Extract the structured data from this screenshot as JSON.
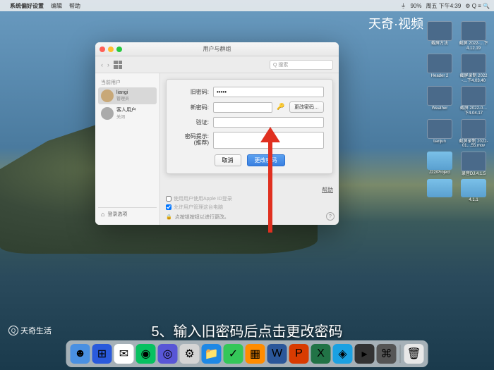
{
  "menubar": {
    "apple": "",
    "app": "系统偏好设置",
    "items": [
      "编辑",
      "帮助"
    ],
    "right": {
      "wifi": "⏚",
      "battery": "90%",
      "time": "周五 下午4:39",
      "icons": "⚙ Q ≡ 🔍"
    }
  },
  "watermark": "天奇·视频",
  "desktop": {
    "items": [
      {
        "type": "thumb",
        "label": "截屏方法"
      },
      {
        "type": "thumb",
        "label": "截屏\n2022-…下4.12.19"
      },
      {
        "type": "thumb",
        "label": "Header 2"
      },
      {
        "type": "thumb",
        "label": "截屏录制\n2022-…下4.03.40"
      },
      {
        "type": "thumb",
        "label": "Weather"
      },
      {
        "type": "thumb",
        "label": "截屏\n2022-0…下4.04.17"
      },
      {
        "type": "thumb",
        "label": "tianjun"
      },
      {
        "type": "thumb",
        "label": "截屏录制\n2022-01…55.mov"
      },
      {
        "type": "folder",
        "label": "J22/Project"
      },
      {
        "type": "thumb",
        "label": "录音DJ.4.1.5"
      },
      {
        "type": "folder",
        "label": ""
      },
      {
        "type": "folder",
        "label": "4.1.1"
      }
    ]
  },
  "modal": {
    "title": "用户与群组",
    "search_placeholder": "Q 搜索",
    "sidebar": {
      "section": "当前用户",
      "users": [
        {
          "name": "liangi",
          "role": "管理员",
          "active": true
        },
        {
          "name": "客人用户",
          "role": "关闭",
          "active": false
        }
      ],
      "login_options": "登录选项"
    },
    "form": {
      "old_password": {
        "label": "旧密码:",
        "value": "•••••"
      },
      "new_password": {
        "label": "新密码:",
        "value": ""
      },
      "verify": {
        "label": "验证:",
        "value": ""
      },
      "hint": {
        "label": "密码提示:\n(推荐)",
        "value": ""
      },
      "change_side": "更改密码…",
      "cancel": "取消",
      "confirm": "更改密码"
    },
    "bottom": {
      "help": "帮助",
      "check1": "使用用户使用Apple ID登录",
      "check2": "允许用户管理这台电脑",
      "lock": "点按锁按钮以进行更改。"
    }
  },
  "caption": "5、输入旧密码后点击更改密码",
  "brand": "天奇生活",
  "dock": {
    "items": [
      {
        "bg": "#4a90e2",
        "icon": "☻"
      },
      {
        "bg": "#2a5adc",
        "icon": "⊞"
      },
      {
        "bg": "#fff",
        "icon": "✉"
      },
      {
        "bg": "#07c160",
        "icon": "◉"
      },
      {
        "bg": "#5856d6",
        "icon": "◎"
      },
      {
        "bg": "#d4d4d4",
        "icon": "⚙"
      },
      {
        "bg": "#1e88e5",
        "icon": "📁"
      },
      {
        "bg": "#34c759",
        "icon": "✓"
      },
      {
        "bg": "#ff8c00",
        "icon": "▦"
      },
      {
        "bg": "#2b579a",
        "icon": "W"
      },
      {
        "bg": "#d83b01",
        "icon": "P"
      },
      {
        "bg": "#217346",
        "icon": "X"
      },
      {
        "bg": "#1ba1e2",
        "icon": "◈"
      },
      {
        "bg": "#333",
        "icon": "▸"
      },
      {
        "bg": "#555",
        "icon": "⌘"
      },
      {
        "bg": "#e8e8e8",
        "icon": "🗑"
      }
    ]
  }
}
